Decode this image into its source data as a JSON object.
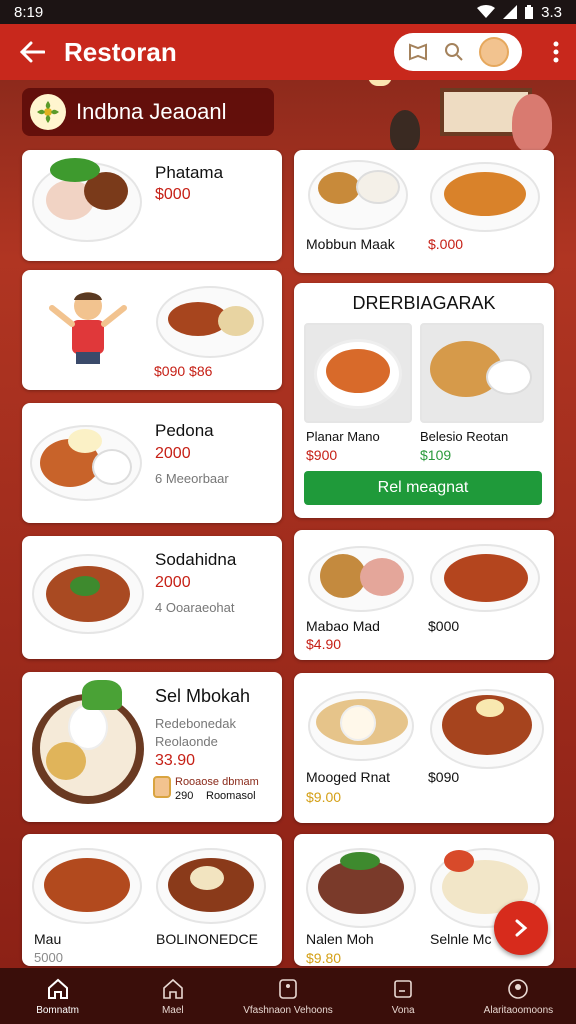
{
  "status": {
    "time": "8:19",
    "battery": "3.3"
  },
  "appbar": {
    "title": "Restoran",
    "back_icon": "back-arrow-icon",
    "more_icon": "more-vert-icon"
  },
  "restaurant": {
    "name": "Indbna Jeaoanl"
  },
  "cards": {
    "c1": {
      "name": "Phatama",
      "price": "$000"
    },
    "c2": {
      "name": "Mobbun Maak",
      "price": "$.000"
    },
    "c3": {
      "price": "$090 $86"
    },
    "featured": {
      "title": "DRERBIAGARAK",
      "item1": {
        "name": "Planar Mano",
        "price": "$900"
      },
      "item2": {
        "name": "Belesio Reotan",
        "price": "$109"
      },
      "button": "Rel meagnat"
    },
    "c5": {
      "name": "Pedona",
      "price": "2000",
      "sub": "6 Meeorbaar"
    },
    "c6": {
      "name": "Sodahidna",
      "price": "2000",
      "sub": "4 Ooaraeohat"
    },
    "c7": {
      "item1": {
        "name": "Mabao Mad",
        "price": "$4.90"
      },
      "item2": {
        "price": "$000"
      }
    },
    "c8": {
      "name": "Sel Mbokah",
      "desc1": "Redebonedak",
      "desc2": "Reolaonde",
      "price": "33.90",
      "review_name": "Rooaose dbmam",
      "review_price": "290",
      "review_place": "Roomasol"
    },
    "c9": {
      "item1": {
        "name": "Mooged Rnat",
        "price": "$9.00"
      },
      "item2": {
        "price": "$090"
      }
    },
    "c10": {
      "item1": {
        "name": "Mau",
        "price": "5000"
      },
      "item2": {
        "name": "BOLINONEDCE"
      }
    },
    "c11": {
      "item1": {
        "name": "Nalen Moh",
        "price": "$9.80"
      },
      "item2": {
        "name": "Selnle Mc"
      }
    }
  },
  "bottom_nav": [
    {
      "label": "Bomnatm",
      "icon": "home-icon"
    },
    {
      "label": "Mael",
      "icon": "home-outline-icon"
    },
    {
      "label": "Vfashnaon Vehoons",
      "icon": "card-icon"
    },
    {
      "label": "Vona",
      "icon": "check-box-icon"
    },
    {
      "label": "Alaritaoomoons",
      "icon": "profile-icon"
    }
  ],
  "colors": {
    "primary": "#c8281c",
    "price": "#c62016",
    "button_green": "#1f9a3a",
    "nav_bg": "#3a0e0a"
  }
}
